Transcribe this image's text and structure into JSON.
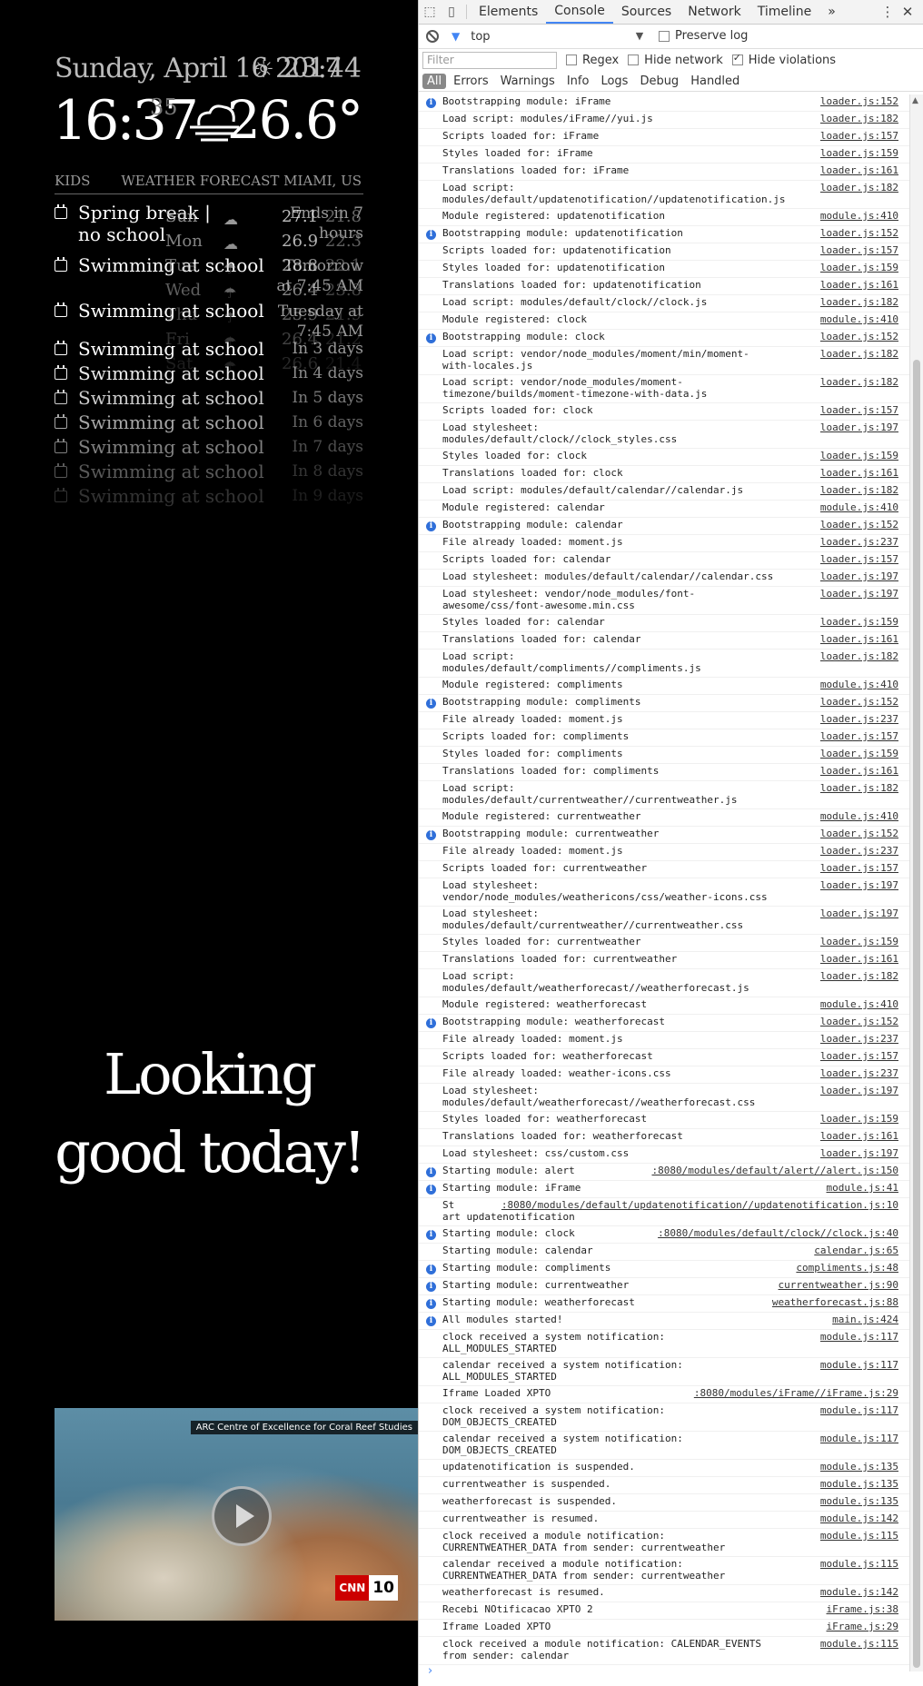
{
  "mirror": {
    "date": "Sunday, April 16 2017",
    "weather_time": "23:44",
    "clock_time": "16:37",
    "clock_seconds": "35",
    "temperature": "26.6°",
    "calendar_header": "KIDS",
    "forecast_header": "WEATHER FORECAST MIAMI, US",
    "events": [
      {
        "title": "Spring break | no school",
        "time": "Ends in 7 hours"
      },
      {
        "title": "Swimming at school",
        "time": "Tomorrow at 7:45 AM"
      },
      {
        "title": "Swimming at school",
        "time": "Tuesday at 7:45 AM"
      },
      {
        "title": "Swimming at school",
        "time": "In 3 days"
      },
      {
        "title": "Swimming at school",
        "time": "In 4 days"
      },
      {
        "title": "Swimming at school",
        "time": "In 5 days"
      },
      {
        "title": "Swimming at school",
        "time": "In 6 days"
      },
      {
        "title": "Swimming at school",
        "time": "In 7 days"
      },
      {
        "title": "Swimming at school",
        "time": "In 8 days"
      },
      {
        "title": "Swimming at school",
        "time": "In 9 days"
      }
    ],
    "forecast": [
      {
        "day": "Sun",
        "icon": "cloud-wind-icon",
        "max": "27.1",
        "min": "21.8"
      },
      {
        "day": "Mon",
        "icon": "cloud-wind-icon",
        "max": "26.9",
        "min": "22.3"
      },
      {
        "day": "Tue",
        "icon": "rain-icon",
        "max": "28.8",
        "min": "22.1"
      },
      {
        "day": "Wed",
        "icon": "rain-icon",
        "max": "26.4",
        "min": "23.8"
      },
      {
        "day": "Thu",
        "icon": "rain-icon",
        "max": "25.9",
        "min": "21.9"
      },
      {
        "day": "Fri",
        "icon": "rain-icon",
        "max": "26.4",
        "min": "21.2"
      },
      {
        "day": "Sat",
        "icon": "rain-icon",
        "max": "26.6",
        "min": "21.4"
      }
    ],
    "compliment": "Looking good today!",
    "video": {
      "caption": "ARC Centre of Excellence for Coral Reef Studies",
      "logo_brand": "CNN",
      "logo_number": "10"
    }
  },
  "devtools": {
    "tabs": [
      "Elements",
      "Console",
      "Sources",
      "Network",
      "Timeline"
    ],
    "active_tab": "Console",
    "more": "»",
    "menu": "⋮",
    "close": "✕",
    "context": "top",
    "preserve_log": "Preserve log",
    "filter_placeholder": "Filter",
    "options": {
      "regex": "Regex",
      "hide_network": "Hide network",
      "hide_violations": "Hide violations"
    },
    "levels": [
      "All",
      "Errors",
      "Warnings",
      "Info",
      "Logs",
      "Debug",
      "Handled"
    ],
    "prompt": "›",
    "log": [
      {
        "info": true,
        "msg": "Bootstrapping module: iFrame",
        "src": "loader.js:152"
      },
      {
        "msg": "Load script: modules/iFrame//yui.js",
        "src": "loader.js:182"
      },
      {
        "msg": "Scripts loaded for: iFrame",
        "src": "loader.js:157"
      },
      {
        "msg": "Styles loaded for: iFrame",
        "src": "loader.js:159"
      },
      {
        "msg": "Translations loaded for: iFrame",
        "src": "loader.js:161"
      },
      {
        "msg": "Load script:\nmodules/default/updatenotification//updatenotification.js",
        "src": "loader.js:182"
      },
      {
        "msg": "Module registered: updatenotification",
        "src": "module.js:410"
      },
      {
        "info": true,
        "msg": "Bootstrapping module: updatenotification",
        "src": "loader.js:152"
      },
      {
        "msg": "Scripts loaded for: updatenotification",
        "src": "loader.js:157"
      },
      {
        "msg": "Styles loaded for: updatenotification",
        "src": "loader.js:159"
      },
      {
        "msg": "Translations loaded for: updatenotification",
        "src": "loader.js:161"
      },
      {
        "msg": "Load script: modules/default/clock//clock.js",
        "src": "loader.js:182"
      },
      {
        "msg": "Module registered: clock",
        "src": "module.js:410"
      },
      {
        "info": true,
        "msg": "Bootstrapping module: clock",
        "src": "loader.js:152"
      },
      {
        "msg": "Load script: vendor/node_modules/moment/min/moment-\nwith-locales.js",
        "src": "loader.js:182"
      },
      {
        "msg": "Load script: vendor/node_modules/moment-\ntimezone/builds/moment-timezone-with-data.js",
        "src": "loader.js:182"
      },
      {
        "msg": "Scripts loaded for: clock",
        "src": "loader.js:157"
      },
      {
        "msg": "Load stylesheet:\nmodules/default/clock//clock_styles.css",
        "src": "loader.js:197"
      },
      {
        "msg": "Styles loaded for: clock",
        "src": "loader.js:159"
      },
      {
        "msg": "Translations loaded for: clock",
        "src": "loader.js:161"
      },
      {
        "msg": "Load script: modules/default/calendar//calendar.js",
        "src": "loader.js:182"
      },
      {
        "msg": "Module registered: calendar",
        "src": "module.js:410"
      },
      {
        "info": true,
        "msg": "Bootstrapping module: calendar",
        "src": "loader.js:152"
      },
      {
        "msg": "File already loaded: moment.js",
        "src": "loader.js:237"
      },
      {
        "msg": "Scripts loaded for: calendar",
        "src": "loader.js:157"
      },
      {
        "msg": "Load stylesheet: modules/default/calendar//calendar.css",
        "src": "loader.js:197"
      },
      {
        "msg": "Load stylesheet: vendor/node_modules/font-\nawesome/css/font-awesome.min.css",
        "src": "loader.js:197"
      },
      {
        "msg": "Styles loaded for: calendar",
        "src": "loader.js:159"
      },
      {
        "msg": "Translations loaded for: calendar",
        "src": "loader.js:161"
      },
      {
        "msg": "Load script:\nmodules/default/compliments//compliments.js",
        "src": "loader.js:182"
      },
      {
        "msg": "Module registered: compliments",
        "src": "module.js:410"
      },
      {
        "info": true,
        "msg": "Bootstrapping module: compliments",
        "src": "loader.js:152"
      },
      {
        "msg": "File already loaded: moment.js",
        "src": "loader.js:237"
      },
      {
        "msg": "Scripts loaded for: compliments",
        "src": "loader.js:157"
      },
      {
        "msg": "Styles loaded for: compliments",
        "src": "loader.js:159"
      },
      {
        "msg": "Translations loaded for: compliments",
        "src": "loader.js:161"
      },
      {
        "msg": "Load script:\nmodules/default/currentweather//currentweather.js",
        "src": "loader.js:182"
      },
      {
        "msg": "Module registered: currentweather",
        "src": "module.js:410"
      },
      {
        "info": true,
        "msg": "Bootstrapping module: currentweather",
        "src": "loader.js:152"
      },
      {
        "msg": "File already loaded: moment.js",
        "src": "loader.js:237"
      },
      {
        "msg": "Scripts loaded for: currentweather",
        "src": "loader.js:157"
      },
      {
        "msg": "Load stylesheet:\nvendor/node_modules/weathericons/css/weather-icons.css",
        "src": "loader.js:197"
      },
      {
        "msg": "Load stylesheet:\nmodules/default/currentweather//currentweather.css",
        "src": "loader.js:197"
      },
      {
        "msg": "Styles loaded for: currentweather",
        "src": "loader.js:159"
      },
      {
        "msg": "Translations loaded for: currentweather",
        "src": "loader.js:161"
      },
      {
        "msg": "Load script:\nmodules/default/weatherforecast//weatherforecast.js",
        "src": "loader.js:182"
      },
      {
        "msg": "Module registered: weatherforecast",
        "src": "module.js:410"
      },
      {
        "info": true,
        "msg": "Bootstrapping module: weatherforecast",
        "src": "loader.js:152"
      },
      {
        "msg": "File already loaded: moment.js",
        "src": "loader.js:237"
      },
      {
        "msg": "Scripts loaded for: weatherforecast",
        "src": "loader.js:157"
      },
      {
        "msg": "File already loaded: weather-icons.css",
        "src": "loader.js:237"
      },
      {
        "msg": "Load stylesheet:\nmodules/default/weatherforecast//weatherforecast.css",
        "src": "loader.js:197"
      },
      {
        "msg": "Styles loaded for: weatherforecast",
        "src": "loader.js:159"
      },
      {
        "msg": "Translations loaded for: weatherforecast",
        "src": "loader.js:161"
      },
      {
        "msg": "Load stylesheet: css/custom.css",
        "src": "loader.js:197"
      },
      {
        "info": true,
        "msg": "Starting module: alert",
        "src": ":8080/modules/default/alert//alert.js:150"
      },
      {
        "info": true,
        "msg": "Starting module: iFrame",
        "src": "module.js:41"
      },
      {
        "msg": "St\nart updatenotification",
        "src": ":8080/modules/default/updatenotification//updatenotification.js:10"
      },
      {
        "info": true,
        "msg": "Starting module: clock",
        "src": ":8080/modules/default/clock//clock.js:40"
      },
      {
        "msg": "Starting module: calendar",
        "src": "calendar.js:65"
      },
      {
        "info": true,
        "msg": "Starting module: compliments",
        "src": "compliments.js:48"
      },
      {
        "info": true,
        "msg": "Starting module: currentweather",
        "src": "currentweather.js:90"
      },
      {
        "info": true,
        "msg": "Starting module: weatherforecast",
        "src": "weatherforecast.js:88"
      },
      {
        "info": true,
        "msg": "All modules started!",
        "src": "main.js:424"
      },
      {
        "msg": "clock received a system notification:\nALL_MODULES_STARTED",
        "src": "module.js:117"
      },
      {
        "msg": "calendar received a system notification:\nALL_MODULES_STARTED",
        "src": "module.js:117"
      },
      {
        "msg": "Iframe Loaded XPTO",
        "src": ":8080/modules/iFrame//iFrame.js:29"
      },
      {
        "msg": "clock received a system notification:\nDOM_OBJECTS_CREATED",
        "src": "module.js:117"
      },
      {
        "msg": "calendar received a system notification:\nDOM_OBJECTS_CREATED",
        "src": "module.js:117"
      },
      {
        "msg": "updatenotification is suspended.",
        "src": "module.js:135"
      },
      {
        "msg": "currentweather is suspended.",
        "src": "module.js:135"
      },
      {
        "msg": "weatherforecast is suspended.",
        "src": "module.js:135"
      },
      {
        "msg": "currentweather is resumed.",
        "src": "module.js:142"
      },
      {
        "msg": "clock received a module notification:\nCURRENTWEATHER_DATA from sender: currentweather",
        "src": "module.js:115"
      },
      {
        "msg": "calendar received a module notification:\nCURRENTWEATHER_DATA from sender: currentweather",
        "src": "module.js:115"
      },
      {
        "msg": "weatherforecast is resumed.",
        "src": "module.js:142"
      },
      {
        "msg": "Recebi NOtificacao XPTO 2",
        "src": "iFrame.js:38"
      },
      {
        "msg": "Iframe Loaded XPTO",
        "src": "iFrame.js:29"
      },
      {
        "msg": "clock received a module notification: CALENDAR_EVENTS\nfrom sender: calendar",
        "src": "module.js:115"
      }
    ]
  }
}
